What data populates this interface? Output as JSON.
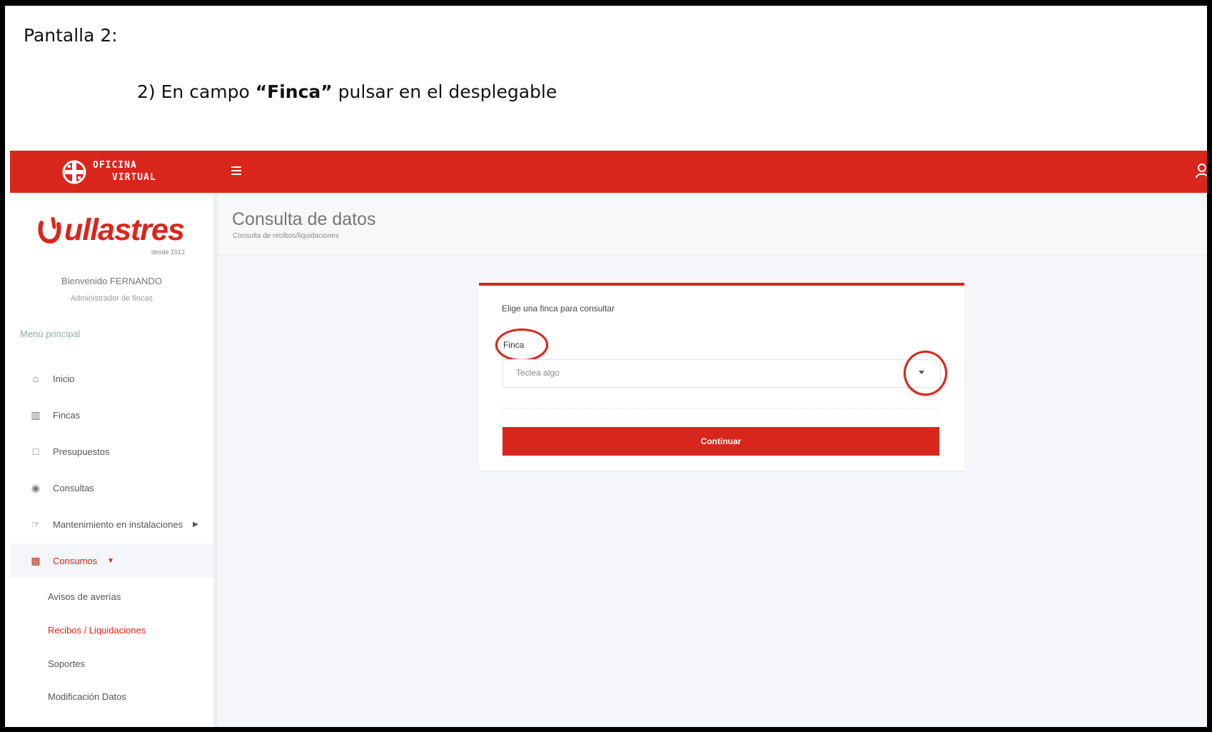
{
  "instructions": {
    "screen_label": "Pantalla 2:",
    "step_prefix": "2)  En campo ",
    "step_bold": "“Finca”",
    "step_suffix": " pulsar en el desplegable"
  },
  "topbar": {
    "logo_line1": "OFICINA",
    "logo_line2": "VIRTUAL",
    "menu_icon": "hamburger-icon",
    "user_icon": "user-icon",
    "color": "#d9261c"
  },
  "sidebar": {
    "brand_name": "ullastres",
    "brand_since": "desde 1912",
    "welcome": "Bienvenido FERNANDO",
    "role": "Administrador de fincas",
    "menu_title": "Menú principal",
    "items": [
      {
        "icon": "home-icon",
        "label": "Inicio"
      },
      {
        "icon": "building-icon",
        "label": "Fincas"
      },
      {
        "icon": "document-icon",
        "label": "Presupuestos"
      },
      {
        "icon": "eye-icon",
        "label": "Consultas"
      },
      {
        "icon": "hand-icon",
        "label": "Mantenimiento en instalaciones"
      },
      {
        "icon": "file-chart-icon",
        "label": "Consumos"
      }
    ],
    "subitems": [
      {
        "label": "Avisos de averías"
      },
      {
        "label": "Recibos / Liquidaciones"
      },
      {
        "label": "Soportes"
      },
      {
        "label": "Modificación Datos"
      }
    ]
  },
  "header": {
    "title": "Consulta de datos",
    "subtitle": "Consulta de recibos/liquidaciones"
  },
  "form": {
    "prompt": "Elige una finca para consultar",
    "field_label": "Finca",
    "select_placeholder": "Teclea algo",
    "submit_label": "Continuar"
  }
}
